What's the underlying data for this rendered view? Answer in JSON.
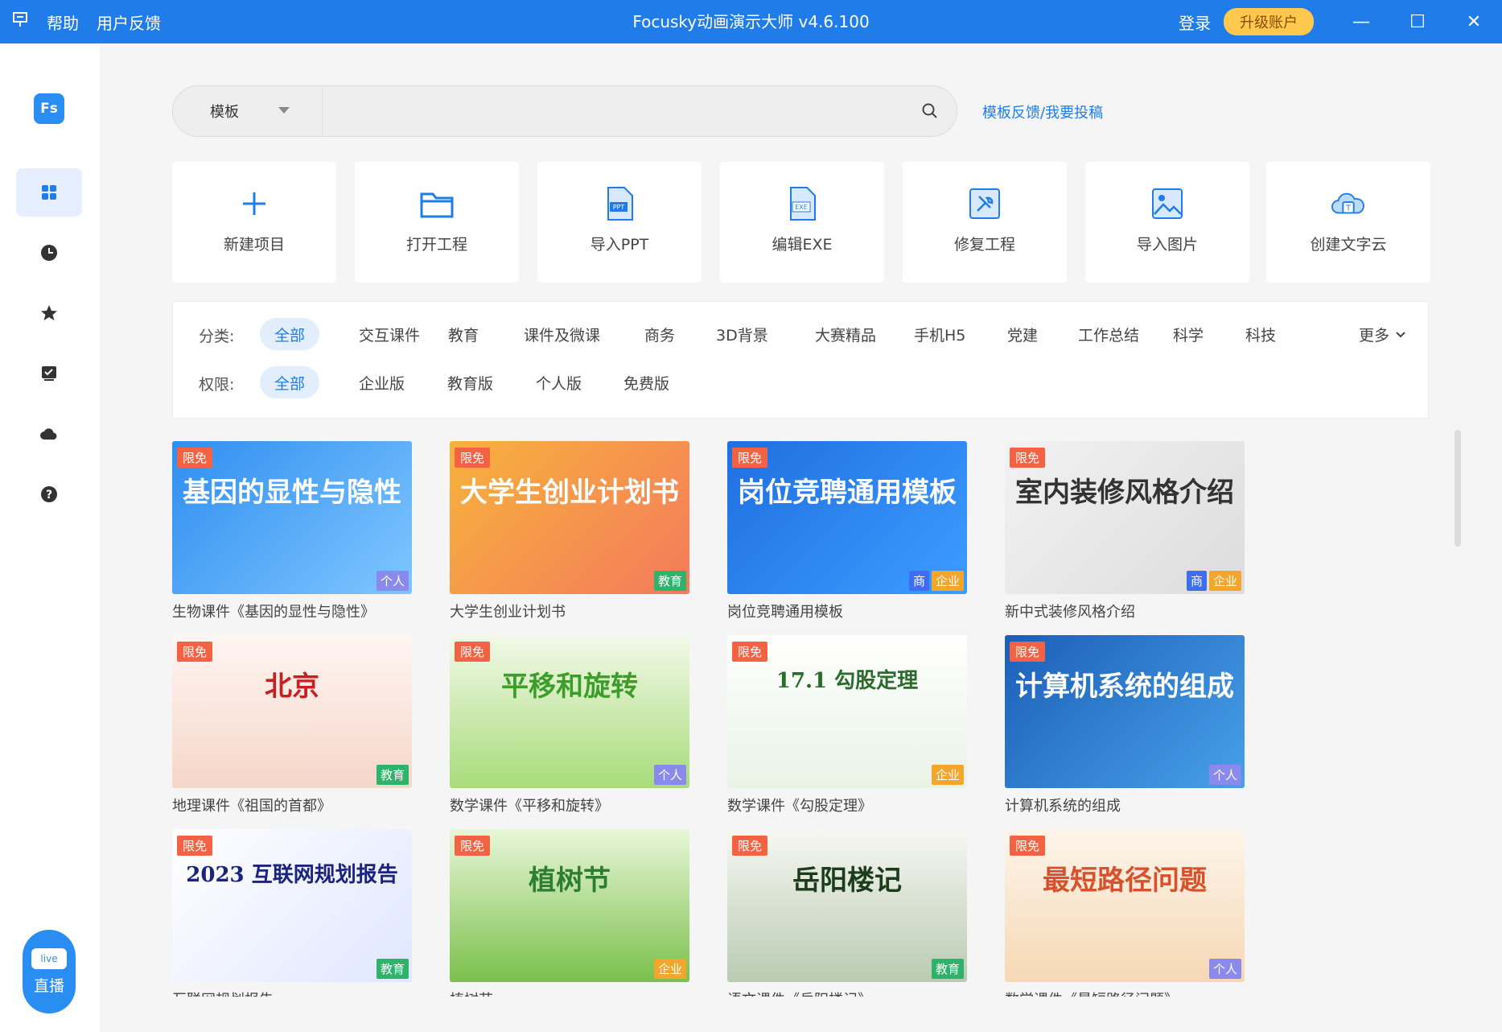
{
  "titlebar": {
    "logo_icon": "presentation-icon",
    "help": "帮助",
    "feedback": "用户反馈",
    "title": "Focusky动画演示大师 v4.6.100",
    "login": "登录",
    "upgrade": "升级账户",
    "minimize": "—",
    "maximize": "☐",
    "close": "✕"
  },
  "sidebar": {
    "logo_text": "Fs",
    "items": [
      {
        "name": "templates",
        "icon": "grid-icon",
        "active": true
      },
      {
        "name": "recent",
        "icon": "clock-icon"
      },
      {
        "name": "favorites",
        "icon": "star-icon"
      },
      {
        "name": "tasks",
        "icon": "checkbox-icon"
      },
      {
        "name": "cloud",
        "icon": "cloud-icon"
      },
      {
        "name": "help",
        "icon": "help-icon"
      }
    ],
    "live_badge": "live",
    "live_label": "直播"
  },
  "search": {
    "type": "模板",
    "placeholder": "",
    "value": ""
  },
  "feedback_link": "模板反馈/我要投稿",
  "actions": [
    {
      "label": "新建项目",
      "icon": "plus-icon"
    },
    {
      "label": "打开工程",
      "icon": "folder-icon"
    },
    {
      "label": "导入PPT",
      "icon": "ppt-file-icon",
      "badge": "PPT"
    },
    {
      "label": "编辑EXE",
      "icon": "exe-file-icon",
      "badge": "EXE"
    },
    {
      "label": "修复工程",
      "icon": "repair-icon"
    },
    {
      "label": "导入图片",
      "icon": "image-icon"
    },
    {
      "label": "创建文字云",
      "icon": "word-cloud-icon"
    }
  ],
  "filters": {
    "category_label": "分类:",
    "categories": [
      "全部",
      "交互课件",
      "教育",
      "课件及微课",
      "商务",
      "3D背景",
      "大赛精品",
      "手机H5",
      "党建",
      "工作总结",
      "科学",
      "科技"
    ],
    "more": "更多",
    "permission_label": "权限:",
    "permissions": [
      "全部",
      "企业版",
      "教育版",
      "个人版",
      "免费版"
    ]
  },
  "free_tag": "限免",
  "templates": [
    {
      "title": "生物课件《基因的显性与隐性》",
      "cover_text": "基因的显性与隐性",
      "tags": [
        "个人"
      ],
      "bg": "linear-gradient(135deg,#2f8ef0,#7fc6ff)",
      "fg": "#ffffff"
    },
    {
      "title": "大学生创业计划书",
      "cover_text": "大学生创业计划书",
      "tags": [
        "教育"
      ],
      "bg": "linear-gradient(135deg,#f7b23c,#f47a5c)",
      "fg": "#ffffff"
    },
    {
      "title": "岗位竞聘通用模板",
      "cover_text": "岗位竞聘通用模板",
      "tags": [
        "商",
        "企业"
      ],
      "bg": "linear-gradient(135deg,#1f6fe0,#3d9cff)",
      "fg": "#ffffff"
    },
    {
      "title": "新中式装修风格介绍",
      "cover_text": "室内装修风格介绍",
      "tags": [
        "商",
        "企业"
      ],
      "bg": "linear-gradient(135deg,#f2f2f2,#dcdcdc)",
      "fg": "#333333"
    },
    {
      "title": "地理课件《祖国的首都》",
      "cover_text": "北京",
      "tags": [
        "教育"
      ],
      "bg": "linear-gradient(180deg,#fff5f2,#f5d6c9)",
      "fg": "#c62020"
    },
    {
      "title": "数学课件《平移和旋转》",
      "cover_text": "平移和旋转",
      "tags": [
        "个人"
      ],
      "bg": "linear-gradient(180deg,#f2f9e8,#a8dc7a)",
      "fg": "#3d9d2b"
    },
    {
      "title": "数学课件《勾股定理》",
      "cover_text": "17.1 勾股定理",
      "tags": [
        "企业"
      ],
      "bg": "linear-gradient(180deg,#ffffff,#e8f3e6)",
      "fg": "#2b6b2b"
    },
    {
      "title": "计算机系统的组成",
      "cover_text": "计算机系统的组成",
      "tags": [
        "个人"
      ],
      "bg": "linear-gradient(135deg,#1b5fb8,#48a0e8)",
      "fg": "#ffffff"
    },
    {
      "title": "互联网规划报告",
      "cover_text": "2023 互联网规划报告",
      "tags": [
        "教育"
      ],
      "bg": "linear-gradient(135deg,#ffffff,#dfe6ff)",
      "fg": "#1a237e"
    },
    {
      "title": "植树节",
      "cover_text": "植树节",
      "tags": [
        "企业"
      ],
      "bg": "linear-gradient(180deg,#e8f7d8,#7bc04c)",
      "fg": "#2e7d32"
    },
    {
      "title": "语文课件《岳阳楼记》",
      "cover_text": "岳阳楼记",
      "tags": [
        "教育"
      ],
      "bg": "linear-gradient(180deg,#f7f7f2,#b9cbb2)",
      "fg": "#1b3d1b"
    },
    {
      "title": "数学课件《最短路径问题》",
      "cover_text": "最短路径问题",
      "tags": [
        "个人"
      ],
      "bg": "linear-gradient(180deg,#fdf5ea,#f6d8b5)",
      "fg": "#d9502c"
    }
  ],
  "colors": {
    "accent": "#1f7ce8",
    "free": "#f36343",
    "upgrade": "#ffc94d"
  }
}
